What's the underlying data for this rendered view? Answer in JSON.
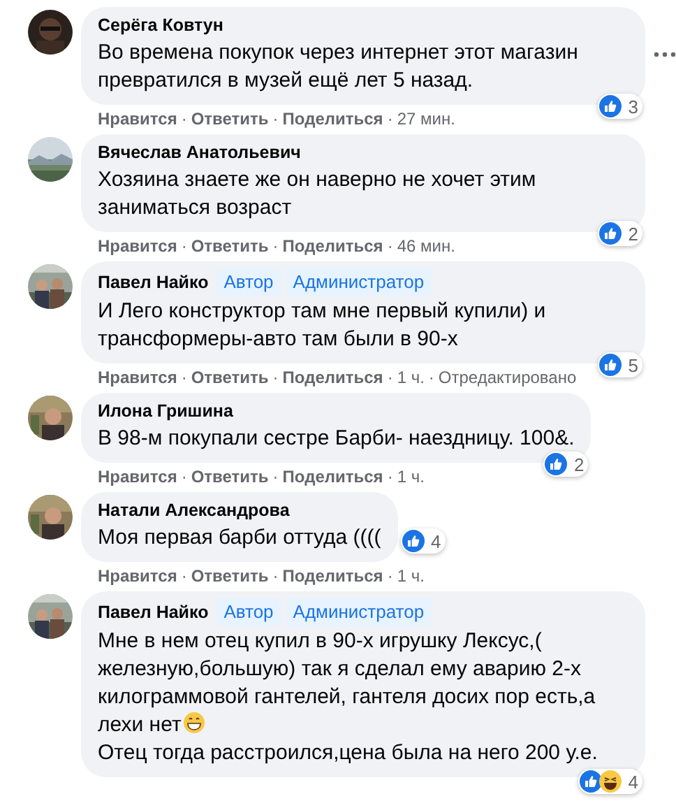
{
  "separator": "·",
  "comments": [
    {
      "author": "Серёга Ковтун",
      "options_visible": true,
      "paragraphs": [
        {
          "text": "Во времена покупок через интернет этот магазин превратился в музей ещё лет 5 назад."
        }
      ],
      "reactions": [
        {
          "kind": "like"
        }
      ],
      "reaction_count": "3",
      "actions": [
        {
          "kind": "link",
          "text": "Нравится"
        },
        {
          "kind": "link",
          "text": "Ответить"
        },
        {
          "kind": "link",
          "text": "Поделиться"
        },
        {
          "kind": "meta",
          "text": "27 мин."
        }
      ]
    },
    {
      "author": "Вячеслав Анатольевич",
      "options_visible": false,
      "paragraphs": [
        {
          "text": "Хозяина знаете же он наверно не хочет этим заниматься возраст"
        }
      ],
      "reactions": [
        {
          "kind": "like"
        }
      ],
      "reaction_count": "2",
      "actions": [
        {
          "kind": "link",
          "text": "Нравится"
        },
        {
          "kind": "link",
          "text": "Ответить"
        },
        {
          "kind": "link",
          "text": "Поделиться"
        },
        {
          "kind": "meta",
          "text": "46 мин."
        }
      ]
    },
    {
      "author": "Павел Найко",
      "badges": [
        "Автор",
        "Администратор"
      ],
      "options_visible": false,
      "paragraphs": [
        {
          "text": "И Лего конструктор там мне первый купили) и трансформеры-авто там были в 90-х"
        }
      ],
      "reactions": [
        {
          "kind": "like"
        }
      ],
      "reaction_count": "5",
      "actions": [
        {
          "kind": "link",
          "text": "Нравится"
        },
        {
          "kind": "link",
          "text": "Ответить"
        },
        {
          "kind": "link",
          "text": "Поделиться"
        },
        {
          "kind": "meta",
          "text": "1 ч."
        },
        {
          "kind": "meta",
          "text": "Отредактировано"
        }
      ]
    },
    {
      "author": "Илона Гришина",
      "options_visible": false,
      "paragraphs": [
        {
          "text": "В 98-м покупали сестре Барби- наездницу. 100&."
        }
      ],
      "reactions": [
        {
          "kind": "like"
        }
      ],
      "reaction_count": "2",
      "actions": [
        {
          "kind": "link",
          "text": "Нравится"
        },
        {
          "kind": "link",
          "text": "Ответить"
        },
        {
          "kind": "link",
          "text": "Поделиться"
        },
        {
          "kind": "meta",
          "text": "1 ч."
        }
      ]
    },
    {
      "author": "Натали Александрова",
      "options_visible": false,
      "paragraphs": [
        {
          "text": "Моя первая барби оттуда (((("
        }
      ],
      "reactions": [
        {
          "kind": "like"
        }
      ],
      "reaction_count": "4",
      "actions": [
        {
          "kind": "link",
          "text": "Нравится"
        },
        {
          "kind": "link",
          "text": "Ответить"
        },
        {
          "kind": "link",
          "text": "Поделиться"
        },
        {
          "kind": "meta",
          "text": "1 ч."
        }
      ]
    },
    {
      "author": "Павел Найко",
      "badges": [
        "Автор",
        "Администратор"
      ],
      "options_visible": false,
      "paragraphs": [
        {
          "text": "Мне в нем отец купил в 90-х игрушку Лексус,( железную,большую) так я сделал ему аварию 2-х килограммовой гантелей, гантеля досих пор есть,а"
        },
        {
          "text": "лехи нет",
          "emoji": true
        },
        {
          "text": "Отец тогда расстроился,цена была на него 200 у.е."
        }
      ],
      "reactions": [
        {
          "kind": "like"
        },
        {
          "kind": "haha"
        }
      ],
      "reaction_count": "4"
    }
  ]
}
